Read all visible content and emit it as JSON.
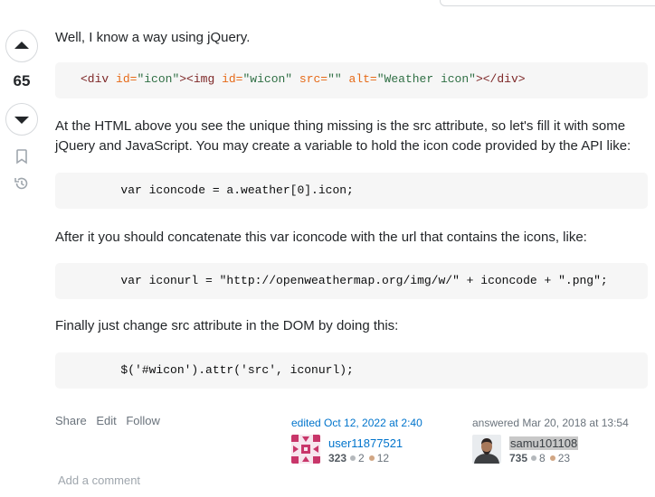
{
  "vote": {
    "count": "65",
    "upvote_icon": "arrow-up-icon",
    "downvote_icon": "arrow-down-icon",
    "bookmark_icon": "bookmark-icon",
    "history_icon": "history-icon"
  },
  "body": {
    "p1": "Well, I know a way using jQuery.",
    "code1": {
      "t1": "<div",
      "t2": " id=",
      "t3": "\"icon\"",
      "t4": "><img",
      "t5": " id=",
      "t6": "\"wicon\"",
      "t7": " src=",
      "t8": "\"\"",
      "t9": " alt=",
      "t10": "\"Weather icon\"",
      "t11": "></div>"
    },
    "p2_line1": "At the HTML above you see the unique thing missing is the src attribute, so let's fill it with some",
    "p2_line2": "jQuery and JavaScript. You may create a variable to hold the icon code provided by the API like:",
    "code2": "        var iconcode = a.weather[0].icon;",
    "p3": "After it you should concatenate this var iconcode with the url that contains the icons, like:",
    "code3": "        var iconurl = \"http://openweathermap.org/img/w/\" + iconcode + \".png\";",
    "p4": "Finally just change src attribute in the DOM by doing this:",
    "code4": "        $('#wicon').attr('src', iconurl);"
  },
  "actions": {
    "share": "Share",
    "edit": "Edit",
    "follow": "Follow"
  },
  "editor": {
    "label": "edited Oct 12, 2022 at 2:40",
    "name": "user11877521",
    "reputation": "323",
    "silver": "2",
    "bronze": "12"
  },
  "author": {
    "label": "answered Mar 20, 2018 at 13:54",
    "name": "samu101108",
    "reputation": "735",
    "silver": "8",
    "bronze": "23"
  },
  "comments": {
    "add_label": "Add a comment"
  },
  "colors": {
    "link": "#0074cc",
    "code_bg": "#f6f6f6",
    "identicon": "#c8366a"
  }
}
